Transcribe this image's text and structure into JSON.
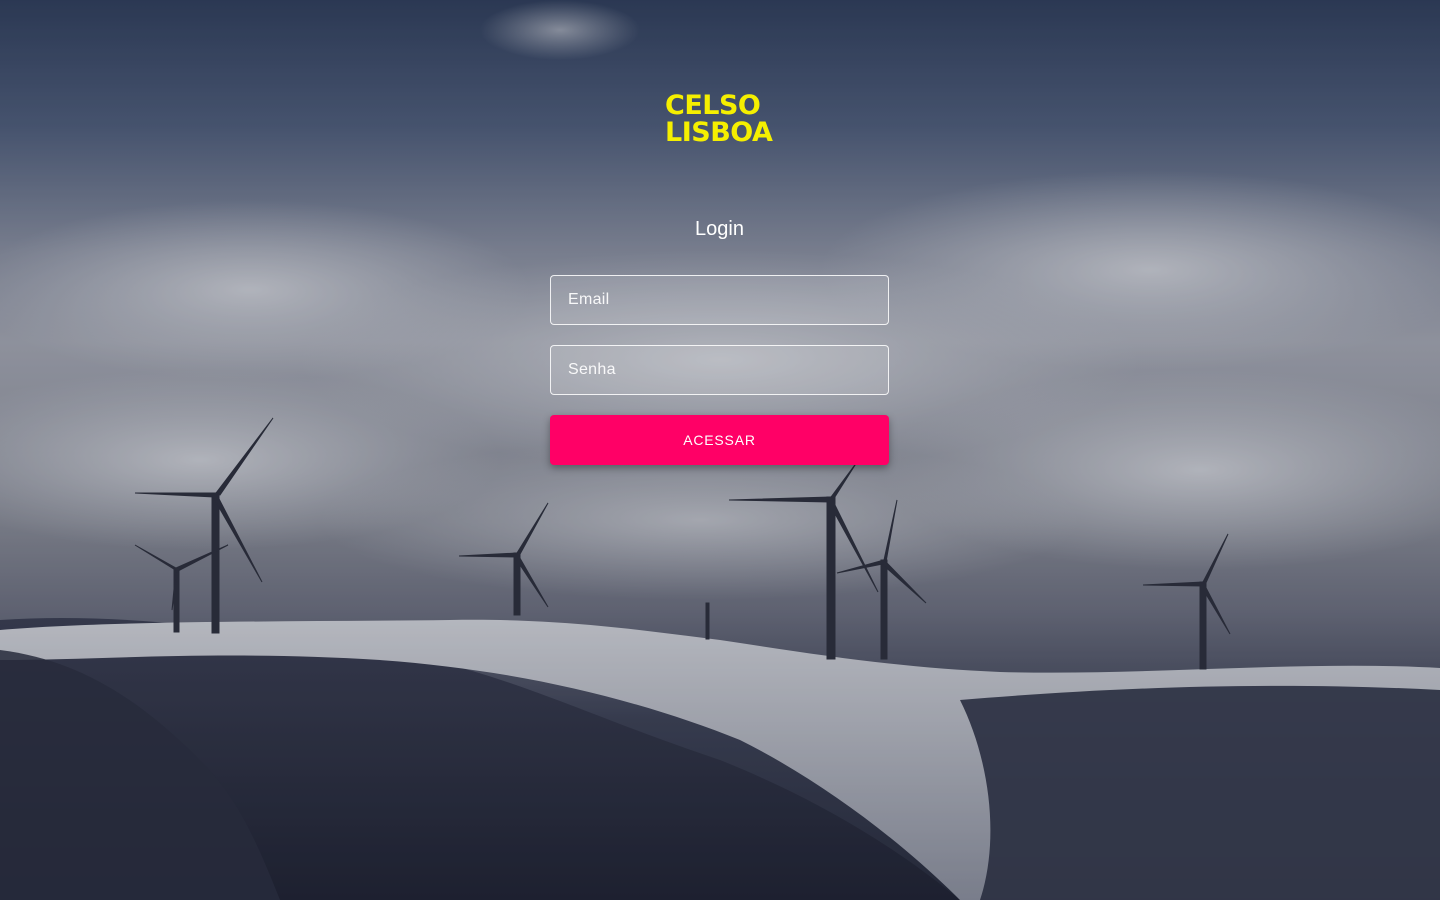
{
  "logo": {
    "line1": "CELSO",
    "line2": "LISBOA",
    "color": "#f5ef00"
  },
  "form": {
    "title": "Login",
    "email_placeholder": "Email",
    "password_placeholder": "Senha",
    "submit_label": "ACESSAR"
  },
  "colors": {
    "accent": "#ff0066",
    "text": "#ffffff"
  },
  "background": {
    "scene": "wind-turbines-snowy-hill-icon"
  }
}
